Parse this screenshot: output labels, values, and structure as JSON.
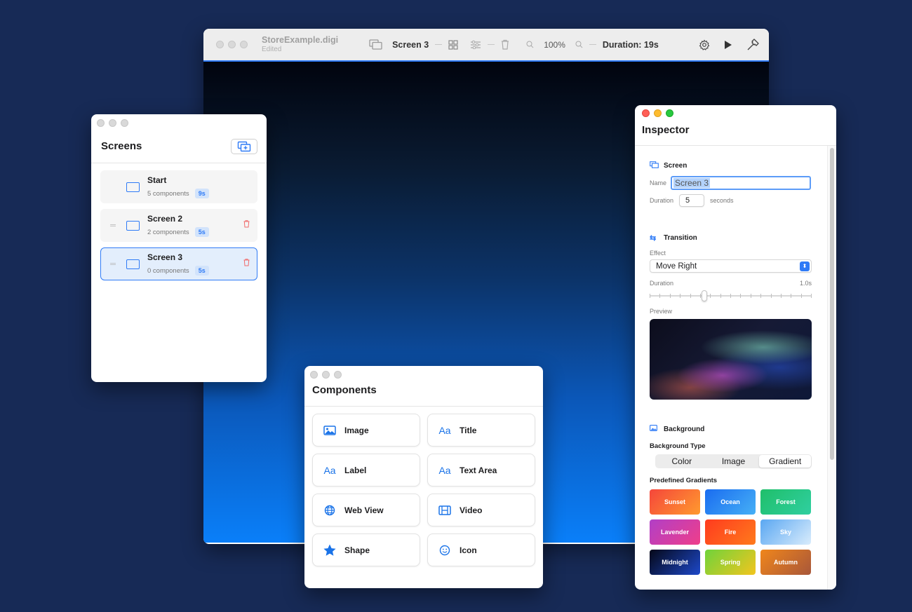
{
  "main_window": {
    "doc_name": "StoreExample.digi",
    "doc_status": "Edited",
    "screen_label": "Screen 3",
    "zoom": "100%",
    "duration": "Duration: 19s"
  },
  "screens_panel": {
    "title": "Screens",
    "items": [
      {
        "name": "Start",
        "components": "5 components",
        "duration": "9s",
        "selected": false
      },
      {
        "name": "Screen 2",
        "components": "2 components",
        "duration": "5s",
        "selected": false
      },
      {
        "name": "Screen 3",
        "components": "0 components",
        "duration": "5s",
        "selected": true
      }
    ]
  },
  "components_panel": {
    "title": "Components",
    "items": [
      {
        "label": "Image",
        "icon": "image-icon"
      },
      {
        "label": "Title",
        "icon": "text-aa-icon"
      },
      {
        "label": "Label",
        "icon": "text-aa-icon"
      },
      {
        "label": "Text Area",
        "icon": "text-aa-icon"
      },
      {
        "label": "Web View",
        "icon": "globe-icon"
      },
      {
        "label": "Video",
        "icon": "film-icon"
      },
      {
        "label": "Shape",
        "icon": "star-icon"
      },
      {
        "label": "Icon",
        "icon": "smiley-icon"
      }
    ]
  },
  "inspector": {
    "title": "Inspector",
    "screen_section": {
      "title": "Screen",
      "name_label": "Name",
      "name_value": "Screen 3",
      "duration_label": "Duration",
      "duration_value": "5",
      "duration_unit": "seconds"
    },
    "transition_section": {
      "title": "Transition",
      "effect_label": "Effect",
      "effect_value": "Move Right",
      "duration_label": "Duration",
      "duration_value": "1.0s",
      "slider_level": 0.33,
      "preview_label": "Preview"
    },
    "background_section": {
      "title": "Background",
      "type_label": "Background Type",
      "type_options": [
        "Color",
        "Image",
        "Gradient"
      ],
      "type_selected": "Gradient",
      "gradients_label": "Predefined Gradients",
      "gradients": [
        {
          "name": "Sunset",
          "from": "#f5463b",
          "to": "#ff9a2e"
        },
        {
          "name": "Ocean",
          "from": "#1a6cf0",
          "to": "#46b0f6"
        },
        {
          "name": "Forest",
          "from": "#1fbf6a",
          "to": "#30cfa0"
        },
        {
          "name": "Lavender",
          "from": "#b13fc7",
          "to": "#ef3e8a"
        },
        {
          "name": "Fire",
          "from": "#ff3b1f",
          "to": "#ff7a1c"
        },
        {
          "name": "Sky",
          "from": "#5aa7f2",
          "to": "#d9ecfc"
        },
        {
          "name": "Midnight",
          "from": "#050818",
          "to": "#1d48c9"
        },
        {
          "name": "Spring",
          "from": "#6fd33b",
          "to": "#f2c51e"
        },
        {
          "name": "Autumn",
          "from": "#f0861b",
          "to": "#a8573a"
        }
      ]
    }
  }
}
